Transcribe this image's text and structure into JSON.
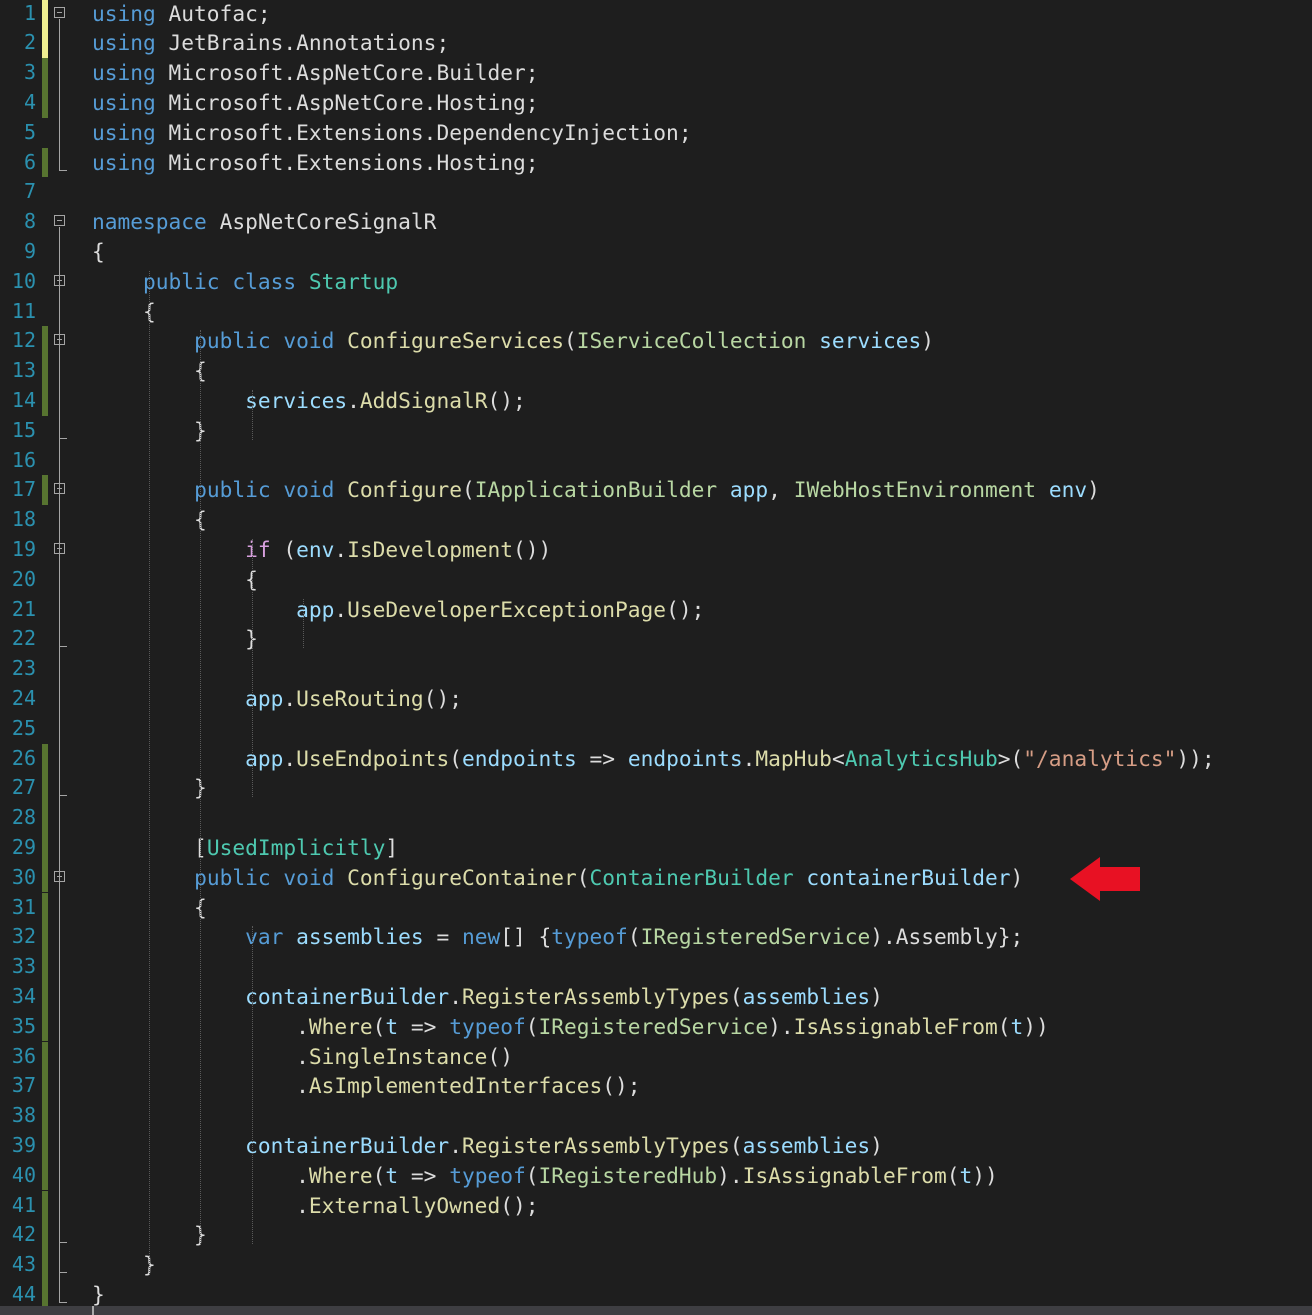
{
  "editor": {
    "language": "csharp",
    "colors": {
      "background": "#1e1e1e",
      "line_number": "#2b91af",
      "keyword": "#569cd6",
      "control_keyword": "#d8a0df",
      "type": "#4ec9b0",
      "interface": "#b8d7a3",
      "method": "#dcdcaa",
      "variable": "#9cdcfe",
      "string": "#d69d85",
      "default": "#dcdcdc",
      "change_saved": "#577430",
      "change_unsaved": "#efef91",
      "annotation_arrow": "#e81123"
    },
    "lines": [
      {
        "n": "1",
        "change": "unsaved",
        "fold": "start",
        "tokens": [
          [
            "using",
            "kw"
          ],
          [
            " Autofac;",
            "p"
          ]
        ]
      },
      {
        "n": "2",
        "change": "unsaved",
        "tokens": [
          [
            "using",
            "kw"
          ],
          [
            " JetBrains",
            "p"
          ],
          [
            ".",
            "p"
          ],
          [
            "Annotations",
            "p"
          ],
          [
            ";",
            "p"
          ]
        ]
      },
      {
        "n": "3",
        "change": "saved",
        "tokens": [
          [
            "using",
            "kw"
          ],
          [
            " Microsoft",
            "p"
          ],
          [
            ".",
            "p"
          ],
          [
            "AspNetCore",
            "p"
          ],
          [
            ".",
            "p"
          ],
          [
            "Builder",
            "p"
          ],
          [
            ";",
            "p"
          ]
        ]
      },
      {
        "n": "4",
        "change": "saved",
        "tokens": [
          [
            "using",
            "kw"
          ],
          [
            " Microsoft",
            "p"
          ],
          [
            ".",
            "p"
          ],
          [
            "AspNetCore",
            "p"
          ],
          [
            ".",
            "p"
          ],
          [
            "Hosting",
            "p"
          ],
          [
            ";",
            "p"
          ]
        ]
      },
      {
        "n": "5",
        "tokens": [
          [
            "using",
            "kw"
          ],
          [
            " Microsoft",
            "p"
          ],
          [
            ".",
            "p"
          ],
          [
            "Extensions",
            "p"
          ],
          [
            ".",
            "p"
          ],
          [
            "DependencyInjection",
            "p"
          ],
          [
            ";",
            "p"
          ]
        ]
      },
      {
        "n": "6",
        "change": "saved",
        "fold": "end",
        "tokens": [
          [
            "using",
            "kw"
          ],
          [
            " Microsoft",
            "p"
          ],
          [
            ".",
            "p"
          ],
          [
            "Extensions",
            "p"
          ],
          [
            ".",
            "p"
          ],
          [
            "Hosting",
            "p"
          ],
          [
            ";",
            "p"
          ]
        ]
      },
      {
        "n": "7",
        "tokens": []
      },
      {
        "n": "8",
        "fold": "start",
        "tokens": [
          [
            "namespace",
            "kw"
          ],
          [
            " AspNetCoreSignalR",
            "p"
          ]
        ]
      },
      {
        "n": "9",
        "tokens": [
          [
            "{",
            "p"
          ]
        ]
      },
      {
        "n": "10",
        "fold": "start",
        "tokens": [
          [
            "    ",
            "p"
          ],
          [
            "public",
            "kw"
          ],
          [
            " ",
            "p"
          ],
          [
            "class",
            "kw"
          ],
          [
            " ",
            "p"
          ],
          [
            "Startup",
            "ty"
          ]
        ]
      },
      {
        "n": "11",
        "tokens": [
          [
            "    {",
            "p"
          ]
        ]
      },
      {
        "n": "12",
        "change": "saved",
        "fold": "start",
        "tokens": [
          [
            "        ",
            "p"
          ],
          [
            "public",
            "kw"
          ],
          [
            " ",
            "p"
          ],
          [
            "void",
            "kw"
          ],
          [
            " ",
            "p"
          ],
          [
            "ConfigureServices",
            "fn"
          ],
          [
            "(",
            "p"
          ],
          [
            "IServiceCollection",
            "if"
          ],
          [
            " ",
            "p"
          ],
          [
            "services",
            "va"
          ],
          [
            ")",
            "p"
          ]
        ]
      },
      {
        "n": "13",
        "change": "saved",
        "tokens": [
          [
            "        {",
            "p"
          ]
        ]
      },
      {
        "n": "14",
        "change": "saved",
        "tokens": [
          [
            "            ",
            "p"
          ],
          [
            "services",
            "va"
          ],
          [
            ".",
            "p"
          ],
          [
            "AddSignalR",
            "fn"
          ],
          [
            "();",
            "p"
          ]
        ]
      },
      {
        "n": "15",
        "fold": "end",
        "tokens": [
          [
            "        }",
            "p"
          ]
        ]
      },
      {
        "n": "16",
        "tokens": []
      },
      {
        "n": "17",
        "change": "saved",
        "fold": "start",
        "tokens": [
          [
            "        ",
            "p"
          ],
          [
            "public",
            "kw"
          ],
          [
            " ",
            "p"
          ],
          [
            "void",
            "kw"
          ],
          [
            " ",
            "p"
          ],
          [
            "Configure",
            "fn"
          ],
          [
            "(",
            "p"
          ],
          [
            "IApplicationBuilder",
            "if"
          ],
          [
            " ",
            "p"
          ],
          [
            "app",
            "va"
          ],
          [
            ", ",
            "p"
          ],
          [
            "IWebHostEnvironment",
            "if"
          ],
          [
            " ",
            "p"
          ],
          [
            "env",
            "va"
          ],
          [
            ")",
            "p"
          ]
        ]
      },
      {
        "n": "18",
        "tokens": [
          [
            "        {",
            "p"
          ]
        ]
      },
      {
        "n": "19",
        "fold": "start",
        "tokens": [
          [
            "            ",
            "p"
          ],
          [
            "if",
            "ck"
          ],
          [
            " (",
            "p"
          ],
          [
            "env",
            "va"
          ],
          [
            ".",
            "p"
          ],
          [
            "IsDevelopment",
            "fn"
          ],
          [
            "())",
            "p"
          ]
        ]
      },
      {
        "n": "20",
        "tokens": [
          [
            "            {",
            "p"
          ]
        ]
      },
      {
        "n": "21",
        "tokens": [
          [
            "                ",
            "p"
          ],
          [
            "app",
            "va"
          ],
          [
            ".",
            "p"
          ],
          [
            "UseDeveloperExceptionPage",
            "fn"
          ],
          [
            "();",
            "p"
          ]
        ]
      },
      {
        "n": "22",
        "fold": "end",
        "tokens": [
          [
            "            }",
            "p"
          ]
        ]
      },
      {
        "n": "23",
        "tokens": []
      },
      {
        "n": "24",
        "tokens": [
          [
            "            ",
            "p"
          ],
          [
            "app",
            "va"
          ],
          [
            ".",
            "p"
          ],
          [
            "UseRouting",
            "fn"
          ],
          [
            "();",
            "p"
          ]
        ]
      },
      {
        "n": "25",
        "tokens": []
      },
      {
        "n": "26",
        "change": "saved",
        "tokens": [
          [
            "            ",
            "p"
          ],
          [
            "app",
            "va"
          ],
          [
            ".",
            "p"
          ],
          [
            "UseEndpoints",
            "fn"
          ],
          [
            "(",
            "p"
          ],
          [
            "endpoints",
            "va"
          ],
          [
            " => ",
            "p"
          ],
          [
            "endpoints",
            "va"
          ],
          [
            ".",
            "p"
          ],
          [
            "MapHub",
            "fn"
          ],
          [
            "<",
            "p"
          ],
          [
            "AnalyticsHub",
            "ty"
          ],
          [
            ">(",
            "p"
          ],
          [
            "\"/analytics\"",
            "st"
          ],
          [
            "));",
            "p"
          ]
        ]
      },
      {
        "n": "27",
        "change": "saved",
        "fold": "end",
        "tokens": [
          [
            "        }",
            "p"
          ]
        ]
      },
      {
        "n": "28",
        "change": "saved",
        "tokens": []
      },
      {
        "n": "29",
        "change": "saved",
        "tokens": [
          [
            "        [",
            "p"
          ],
          [
            "UsedImplicitly",
            "ty"
          ],
          [
            "]",
            "p"
          ]
        ]
      },
      {
        "n": "30",
        "change": "saved",
        "fold": "start",
        "tokens": [
          [
            "        ",
            "p"
          ],
          [
            "public",
            "kw"
          ],
          [
            " ",
            "p"
          ],
          [
            "void",
            "kw"
          ],
          [
            " ",
            "p"
          ],
          [
            "ConfigureContainer",
            "fn"
          ],
          [
            "(",
            "p"
          ],
          [
            "ContainerBuilder",
            "ty"
          ],
          [
            " ",
            "p"
          ],
          [
            "containerBuilder",
            "va"
          ],
          [
            ")",
            "p"
          ]
        ]
      },
      {
        "n": "31",
        "change": "saved",
        "tokens": [
          [
            "        {",
            "p"
          ]
        ]
      },
      {
        "n": "32",
        "change": "saved",
        "tokens": [
          [
            "            ",
            "p"
          ],
          [
            "var",
            "kw"
          ],
          [
            " ",
            "p"
          ],
          [
            "assemblies",
            "va"
          ],
          [
            " = ",
            "p"
          ],
          [
            "new",
            "kw"
          ],
          [
            "[] {",
            "p"
          ],
          [
            "typeof",
            "kw"
          ],
          [
            "(",
            "p"
          ],
          [
            "IRegisteredService",
            "if"
          ],
          [
            ").",
            "p"
          ],
          [
            "Assembly",
            "p"
          ],
          [
            "};",
            "p"
          ]
        ]
      },
      {
        "n": "33",
        "change": "saved",
        "tokens": []
      },
      {
        "n": "34",
        "change": "saved",
        "tokens": [
          [
            "            ",
            "p"
          ],
          [
            "containerBuilder",
            "va"
          ],
          [
            ".",
            "p"
          ],
          [
            "RegisterAssemblyTypes",
            "fn"
          ],
          [
            "(",
            "p"
          ],
          [
            "assemblies",
            "va"
          ],
          [
            ")",
            "p"
          ]
        ]
      },
      {
        "n": "35",
        "change": "saved",
        "tokens": [
          [
            "                .",
            "p"
          ],
          [
            "Where",
            "fn"
          ],
          [
            "(",
            "p"
          ],
          [
            "t",
            "va"
          ],
          [
            " => ",
            "p"
          ],
          [
            "typeof",
            "kw"
          ],
          [
            "(",
            "p"
          ],
          [
            "IRegisteredService",
            "if"
          ],
          [
            ").",
            "p"
          ],
          [
            "IsAssignableFrom",
            "fn"
          ],
          [
            "(",
            "p"
          ],
          [
            "t",
            "va"
          ],
          [
            "))",
            "p"
          ]
        ]
      },
      {
        "n": "36",
        "change": "saved",
        "tokens": [
          [
            "                .",
            "p"
          ],
          [
            "SingleInstance",
            "fn"
          ],
          [
            "()",
            "p"
          ]
        ]
      },
      {
        "n": "37",
        "change": "saved",
        "tokens": [
          [
            "                .",
            "p"
          ],
          [
            "AsImplementedInterfaces",
            "fn"
          ],
          [
            "();",
            "p"
          ]
        ]
      },
      {
        "n": "38",
        "change": "saved",
        "tokens": []
      },
      {
        "n": "39",
        "change": "saved",
        "tokens": [
          [
            "            ",
            "p"
          ],
          [
            "containerBuilder",
            "va"
          ],
          [
            ".",
            "p"
          ],
          [
            "RegisterAssemblyTypes",
            "fn"
          ],
          [
            "(",
            "p"
          ],
          [
            "assemblies",
            "va"
          ],
          [
            ")",
            "p"
          ]
        ]
      },
      {
        "n": "40",
        "change": "saved",
        "tokens": [
          [
            "                .",
            "p"
          ],
          [
            "Where",
            "fn"
          ],
          [
            "(",
            "p"
          ],
          [
            "t",
            "va"
          ],
          [
            " => ",
            "p"
          ],
          [
            "typeof",
            "kw"
          ],
          [
            "(",
            "p"
          ],
          [
            "IRegisteredHub",
            "if"
          ],
          [
            ").",
            "p"
          ],
          [
            "IsAssignableFrom",
            "fn"
          ],
          [
            "(",
            "p"
          ],
          [
            "t",
            "va"
          ],
          [
            "))",
            "p"
          ]
        ]
      },
      {
        "n": "41",
        "change": "saved",
        "tokens": [
          [
            "                .",
            "p"
          ],
          [
            "ExternallyOwned",
            "fn"
          ],
          [
            "();",
            "p"
          ]
        ]
      },
      {
        "n": "42",
        "change": "saved",
        "fold": "end",
        "tokens": [
          [
            "        }",
            "p"
          ]
        ]
      },
      {
        "n": "43",
        "change": "saved",
        "fold": "end",
        "tokens": [
          [
            "    }",
            "p"
          ]
        ]
      },
      {
        "n": "44",
        "change": "saved",
        "fold": "end",
        "tokens": [
          [
            "}",
            "p"
          ]
        ]
      }
    ]
  },
  "annotation": {
    "arrow_icon": "red-left-arrow-icon",
    "points_to_line": "30"
  }
}
